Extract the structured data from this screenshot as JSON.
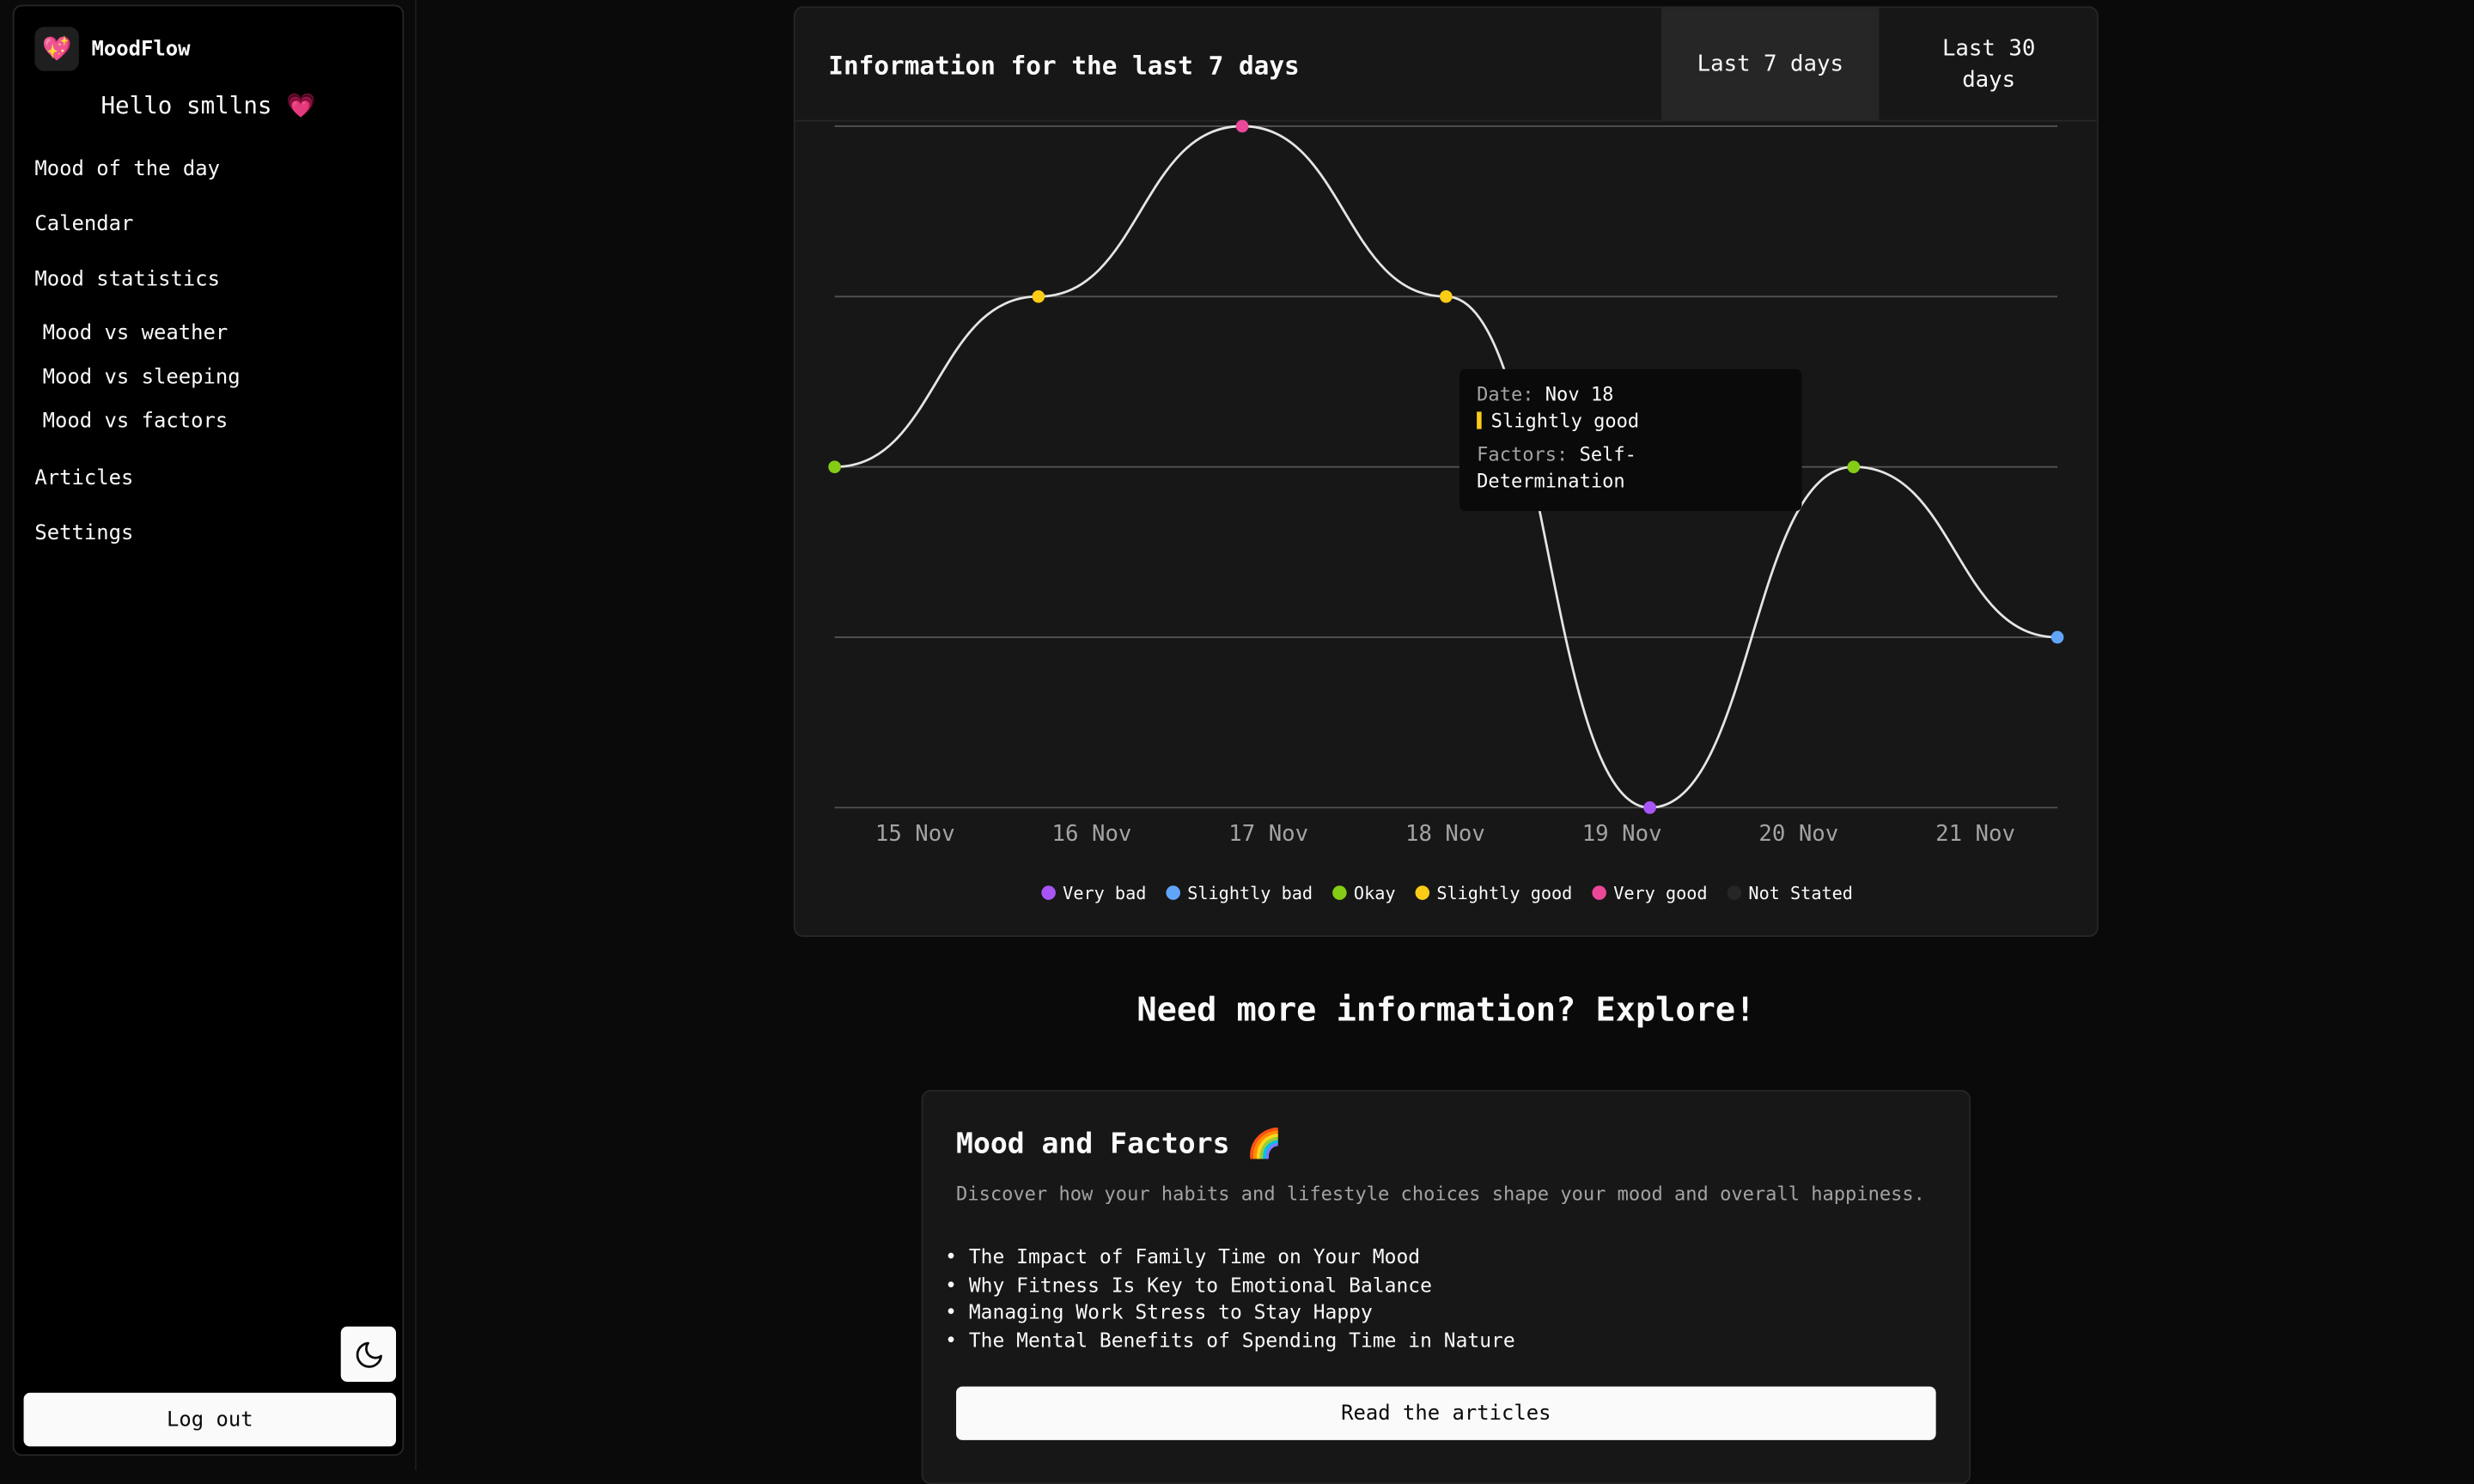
{
  "app": {
    "name": "MoodFlow",
    "logo_icon": "💖",
    "greeting_prefix": "Hello smllns ",
    "greeting_emoji": "💗"
  },
  "sidebar": {
    "items": [
      {
        "label": "Mood of the day"
      },
      {
        "label": "Calendar"
      },
      {
        "label": "Mood statistics"
      },
      {
        "label": "Mood vs weather"
      },
      {
        "label": "Mood vs sleeping"
      },
      {
        "label": "Mood vs factors"
      },
      {
        "label": "Articles"
      },
      {
        "label": "Settings"
      }
    ],
    "theme_icon": "moon-icon",
    "logout_label": "Log out"
  },
  "chart_panel": {
    "title": "Information for the last 7 days",
    "tabs": [
      "Last 7 days",
      "Last 30 days"
    ],
    "active_tab": "Last 7 days"
  },
  "chart_data": {
    "type": "line",
    "categories": [
      "15 Nov",
      "16 Nov",
      "17 Nov",
      "18 Nov",
      "19 Nov",
      "20 Nov",
      "21 Nov"
    ],
    "mood_levels": [
      "Very bad",
      "Slightly bad",
      "Okay",
      "Slightly good",
      "Very good"
    ],
    "values": [
      3,
      4,
      5,
      4,
      1,
      3,
      2
    ],
    "point_moods": [
      "Okay",
      "Slightly good",
      "Very good",
      "Slightly good",
      "Very bad",
      "Okay",
      "Slightly bad"
    ],
    "ylim": [
      1,
      5
    ],
    "grid": true,
    "legend": {
      "placement": "bottom",
      "entries": [
        {
          "label": "Very bad",
          "color": "#a855f7"
        },
        {
          "label": "Slightly bad",
          "color": "#60a5fa"
        },
        {
          "label": "Okay",
          "color": "#84cc16"
        },
        {
          "label": "Slightly good",
          "color": "#facc15"
        },
        {
          "label": "Very good",
          "color": "#ec4899"
        },
        {
          "label": "Not Stated",
          "color": "#262626"
        }
      ]
    },
    "line_color": "#e5e5e5",
    "grid_color": "#525252"
  },
  "tooltip": {
    "date_label": "Date:",
    "date_value": "Nov 18",
    "mood": "Slightly good",
    "mood_color": "#facc15",
    "factors_label": "Factors:",
    "factors_value": "Self-Determination"
  },
  "explore": {
    "title": "Need more information? Explore!"
  },
  "articles_card": {
    "title": "Mood and Factors ",
    "title_emoji": "🌈",
    "description": "Discover how your habits and lifestyle choices shape your mood and overall happiness.",
    "items": [
      "The Impact of Family Time on Your Mood",
      "Why Fitness Is Key to Emotional Balance",
      "Managing Work Stress to Stay Happy",
      "The Mental Benefits of Spending Time in Nature"
    ],
    "button_label": "Read the articles"
  }
}
